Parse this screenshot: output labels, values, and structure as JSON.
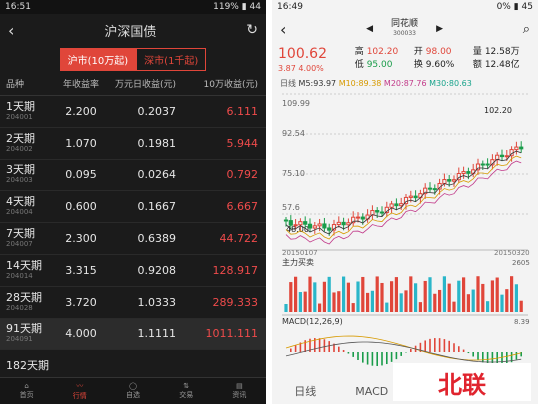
{
  "left": {
    "status": {
      "time": "16:51",
      "battery": "119%",
      "right_num": "44"
    },
    "title": "沪深国债",
    "segments": [
      "沪市(10万起)",
      "深市(1千起)"
    ],
    "headers": [
      "品种",
      "年收益率",
      "万元日收益(元)",
      "10万收益(元)"
    ],
    "rows": [
      {
        "name": "1天期",
        "code": "204001",
        "rate": "2.200",
        "daily": "0.2037",
        "income": "6.111"
      },
      {
        "name": "2天期",
        "code": "204002",
        "rate": "1.070",
        "daily": "0.1981",
        "income": "5.944"
      },
      {
        "name": "3天期",
        "code": "204003",
        "rate": "0.095",
        "daily": "0.0264",
        "income": "0.792"
      },
      {
        "name": "4天期",
        "code": "204004",
        "rate": "0.600",
        "daily": "0.1667",
        "income": "6.667"
      },
      {
        "name": "7天期",
        "code": "204007",
        "rate": "2.300",
        "daily": "0.6389",
        "income": "44.722"
      },
      {
        "name": "14天期",
        "code": "204014",
        "rate": "3.315",
        "daily": "0.9208",
        "income": "128.917"
      },
      {
        "name": "28天期",
        "code": "204028",
        "rate": "3.720",
        "daily": "1.0333",
        "income": "289.333"
      },
      {
        "name": "91天期",
        "code": "204091",
        "rate": "4.000",
        "daily": "1.1111",
        "income": "1011.111"
      },
      {
        "name": "182天期",
        "code": "",
        "rate": "",
        "daily": "",
        "income": ""
      }
    ],
    "nav": [
      "首页",
      "行情",
      "自选",
      "交易",
      "资讯"
    ]
  },
  "right": {
    "status": {
      "time": "16:49",
      "battery": "0%",
      "right_num": "45"
    },
    "stock_name": "同花顺",
    "stock_code": "300033",
    "price": "100.62",
    "change": "3.87",
    "change_pct": "4.00%",
    "high_label": "高",
    "high": "102.20",
    "low_label": "低",
    "low": "95.00",
    "open_label": "开",
    "open": "98.00",
    "turnover_label": "换",
    "turnover": "9.60%",
    "volume_label": "量",
    "volume": "12.58万",
    "amount_label": "额",
    "amount": "12.48亿",
    "ma_line": {
      "period": "日线",
      "m5": "M5:93.97",
      "m10": "M10:89.38",
      "m20": "M20:87.76",
      "m30": "M30:80.63"
    },
    "y_max": "109.99",
    "y_mid": "92.54",
    "y_low": "75.10",
    "y_low2": "57.6",
    "peak_label": "102.20",
    "trough_label": "48.00",
    "date_start": "20150107",
    "date_end": "20150320",
    "flow_label": "主力买卖",
    "flow_value": "2605",
    "macd_label": "MACD(12,26,9)",
    "macd_value": "8.39",
    "tabs": [
      "日线",
      "MACD"
    ]
  },
  "logo_text": "北联",
  "colors": {
    "up": "#e0463a",
    "down": "#1a9c4a",
    "accent": "#e0463a"
  }
}
